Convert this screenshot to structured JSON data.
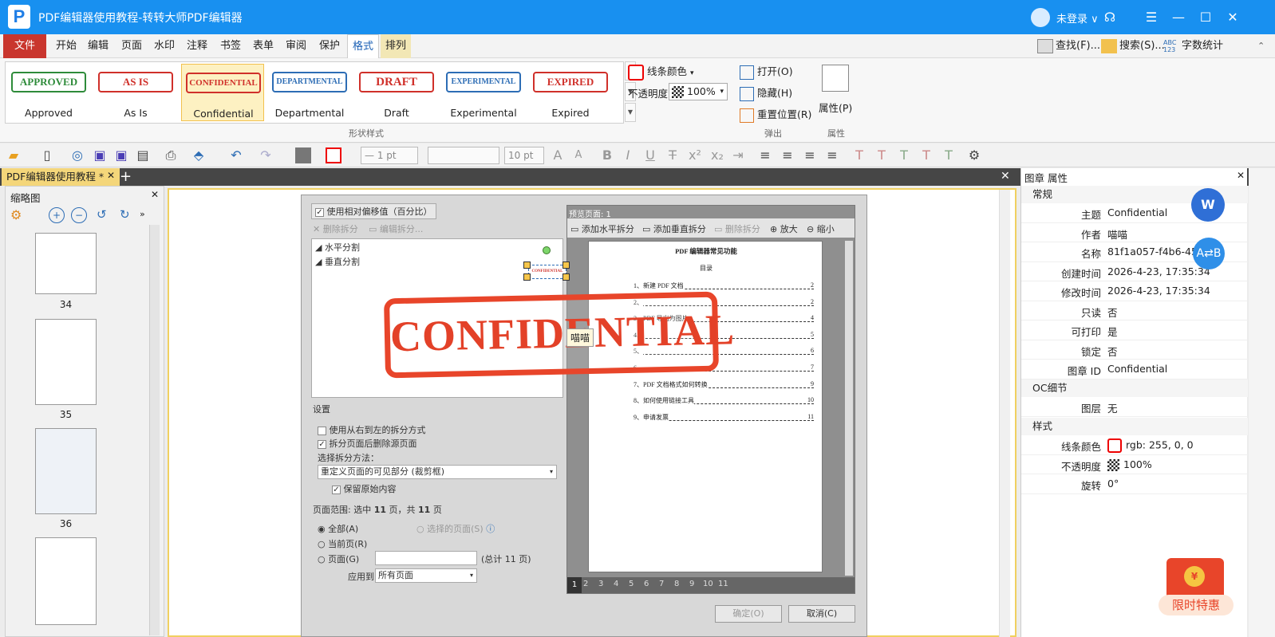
{
  "app": {
    "title": "PDF编辑器使用教程-转转大师PDF编辑器",
    "logo_letter": "P"
  },
  "user": {
    "label": "未登录 ∨"
  },
  "menu": {
    "items": [
      "文件",
      "开始",
      "编辑",
      "页面",
      "水印",
      "注释",
      "书签",
      "表单",
      "审阅",
      "保护",
      "格式",
      "排列"
    ]
  },
  "tools_right": {
    "find": "查找(F)...",
    "search": "搜索(S)...",
    "wordcount": "字数统计"
  },
  "stamps": [
    {
      "label": "Approved",
      "text": "APPROVED",
      "color": "#2e8b3a"
    },
    {
      "label": "As Is",
      "text": "AS IS",
      "color": "#d0302a"
    },
    {
      "label": "Confidential",
      "text": "CONFIDENTIAL",
      "color": "#d0302a"
    },
    {
      "label": "Departmental",
      "text": "DEPARTMENTAL",
      "color": "#2d6db5"
    },
    {
      "label": "Draft",
      "text": "DRAFT",
      "color": "#d0302a"
    },
    {
      "label": "Experimental",
      "text": "EXPERIMENTAL",
      "color": "#2d6db5"
    },
    {
      "label": "Expired",
      "text": "EXPIRED",
      "color": "#d0302a"
    }
  ],
  "ribbon": {
    "shape_style_label": "形状样式",
    "line_color": "线条颜色",
    "opacity_label": "不透明度:",
    "opacity_value": "100%",
    "open": "打开(O)",
    "hide": "隐藏(H)",
    "reset": "重置位置(R)",
    "popup_group": "弹出",
    "properties": "属性(P)",
    "properties_group": "属性"
  },
  "toolbar2": {
    "line_width": "— 1 pt",
    "font_size": "10 pt"
  },
  "doc_tab": {
    "label": "PDF编辑器使用教程 *"
  },
  "thumbs": {
    "title": "缩略图",
    "pages": [
      "34",
      "35",
      "36"
    ]
  },
  "dialog": {
    "relative_offset": "使用相对偏移值（百分比）",
    "delete_split": "删除拆分",
    "edit_split": "编辑拆分...",
    "horizontal": "水平分割",
    "vertical": "垂直分割",
    "preview_title": "预览页面: 1",
    "add_h": "添加水平拆分",
    "add_v": "添加垂直拆分",
    "del_split": "删除拆分",
    "zoom_in": "放大",
    "zoom_out": "缩小",
    "settings": "设置",
    "opt_rtl": "使用从右到左的拆分方式",
    "opt_delete_src": "拆分页面后删除源页面",
    "select_method": "选择拆分方法：",
    "method_value": "重定义页面的可见部分 (裁剪框)",
    "keep_original": "保留原始内容",
    "page_range_prefix": "页面范围: 选中 ",
    "page_range_sel": "11",
    "page_range_mid": " 页，共 ",
    "page_range_total": "11",
    "page_range_suffix": " 页",
    "all": "全部(A)",
    "selected_pages": "选择的页面(S)",
    "current": "当前页(R)",
    "pages": "页面(G)",
    "total_pages": "(总计 11 页)",
    "apply_to": "应用到:",
    "apply_value": "所有页面",
    "ok": "确定(O)",
    "cancel": "取消(C)",
    "page_tabs": [
      "1",
      "2",
      "3",
      "4",
      "5",
      "6",
      "7",
      "8",
      "9",
      "10",
      "11"
    ]
  },
  "preview_doc": {
    "heading": "PDF 编辑器常见功能",
    "toc_title": "目录",
    "entries": [
      {
        "text": "1、新建 PDF 文档",
        "page": "2"
      },
      {
        "text": "2、",
        "page": "2"
      },
      {
        "text": "3、PDF 导出为图片",
        "page": "4"
      },
      {
        "text": "4、",
        "page": "5"
      },
      {
        "text": "5、",
        "page": "6"
      },
      {
        "text": "6、",
        "page": "7"
      },
      {
        "text": "7、PDF 文档格式如何转换",
        "page": "9"
      },
      {
        "text": "8、如何使用链接工具",
        "page": "10"
      },
      {
        "text": "9、申请发票",
        "page": "11"
      }
    ]
  },
  "stamp_overlay": {
    "text": "CONFIDENTIAL",
    "tooltip": "喵喵"
  },
  "props": {
    "title": "图章 属性",
    "sections": [
      "常规",
      "OC细节",
      "样式"
    ],
    "general": [
      {
        "k": "主题",
        "v": "Confidential"
      },
      {
        "k": "作者",
        "v": "喵喵"
      },
      {
        "k": "名称",
        "v": "81f1a057-f4b6-45b"
      },
      {
        "k": "创建时间",
        "v": "2026-4-23, 17:35:34"
      },
      {
        "k": "修改时间",
        "v": "2026-4-23, 17:35:34"
      },
      {
        "k": "只读",
        "v": "否"
      },
      {
        "k": "可打印",
        "v": "是"
      },
      {
        "k": "锁定",
        "v": "否"
      },
      {
        "k": "图章 ID",
        "v": "Confidential"
      }
    ],
    "oc": [
      {
        "k": "图层",
        "v": "无"
      }
    ],
    "style": [
      {
        "k": "线条颜色",
        "v": "rgb: 255, 0, 0"
      },
      {
        "k": "不透明度",
        "v": "100%"
      },
      {
        "k": "旋转",
        "v": "0°"
      }
    ]
  },
  "promo": {
    "label": "限时特惠"
  },
  "colors": {
    "titlebar": "#1890f0",
    "accent_red": "#e8452a",
    "tab_active": "#f4d67a"
  }
}
